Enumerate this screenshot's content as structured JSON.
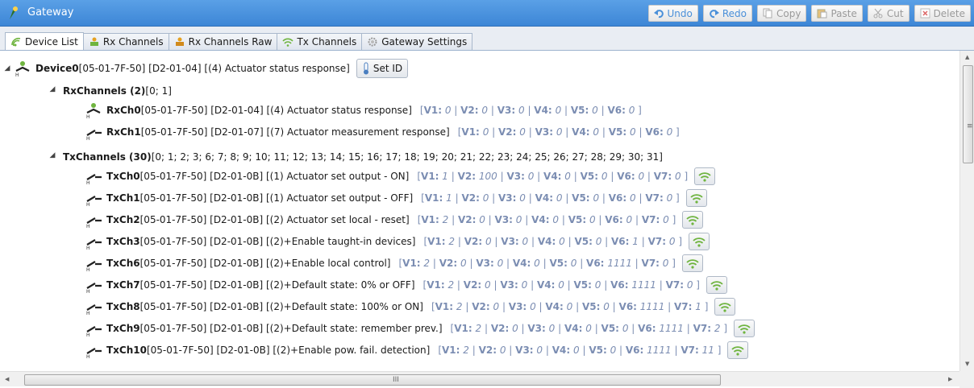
{
  "window": {
    "title": "Gateway"
  },
  "toolbar": [
    {
      "label": "Undo",
      "icon": "undo-icon",
      "active": true
    },
    {
      "label": "Redo",
      "icon": "redo-icon",
      "active": true
    },
    {
      "label": "Copy",
      "icon": "copy-icon",
      "active": false
    },
    {
      "label": "Paste",
      "icon": "paste-icon",
      "active": false
    },
    {
      "label": "Cut",
      "icon": "cut-icon",
      "active": false
    },
    {
      "label": "Delete",
      "icon": "delete-icon",
      "active": false
    }
  ],
  "tabs": [
    {
      "label": "Device List",
      "icon": "device-list-icon",
      "selected": true
    },
    {
      "label": "Rx Channels",
      "icon": "rx-channels-icon",
      "selected": false
    },
    {
      "label": "Rx Channels Raw",
      "icon": "rx-channels-raw-icon",
      "selected": false
    },
    {
      "label": "Tx Channels",
      "icon": "tx-channels-icon",
      "selected": false
    },
    {
      "label": "Gateway Settings",
      "icon": "gateway-settings-icon",
      "selected": false
    }
  ],
  "tree": {
    "device": {
      "name": "Device0",
      "info": " [05-01-7F-50] [D2-01-04] [(4) Actuator status response]",
      "set_id_label": "Set ID"
    },
    "rx_group": {
      "name": "RxChannels (2)",
      "info": " [0; 1]"
    },
    "rx_channels": [
      {
        "name": "RxCh0",
        "info": " [05-01-7F-50] [D2-01-04] [(4) Actuator status response]",
        "vals": [
          [
            "V1:",
            "0"
          ],
          [
            "V2:",
            "0"
          ],
          [
            "V3:",
            "0"
          ],
          [
            "V4:",
            "0"
          ],
          [
            "V5:",
            "0"
          ],
          [
            "V6:",
            "0"
          ]
        ]
      },
      {
        "name": "RxCh1",
        "info": " [05-01-7F-50] [D2-01-07] [(7) Actuator measurement response]",
        "vals": [
          [
            "V1:",
            "0"
          ],
          [
            "V2:",
            "0"
          ],
          [
            "V3:",
            "0"
          ],
          [
            "V4:",
            "0"
          ],
          [
            "V5:",
            "0"
          ],
          [
            "V6:",
            "0"
          ]
        ]
      }
    ],
    "tx_group": {
      "name": "TxChannels (30)",
      "info": " [0; 1; 2; 3; 6; 7; 8; 9; 10; 11; 12; 13; 14; 15; 16; 17; 18; 19; 20; 21; 22; 23; 24; 25; 26; 27; 28; 29; 30; 31]"
    },
    "tx_channels": [
      {
        "name": "TxCh0",
        "info": " [05-01-7F-50] [D2-01-0B] [(1) Actuator set output - ON]",
        "vals": [
          [
            "V1:",
            "1"
          ],
          [
            "V2:",
            "100"
          ],
          [
            "V3:",
            "0"
          ],
          [
            "V4:",
            "0"
          ],
          [
            "V5:",
            "0"
          ],
          [
            "V6:",
            "0"
          ],
          [
            "V7:",
            "0"
          ]
        ]
      },
      {
        "name": "TxCh1",
        "info": " [05-01-7F-50] [D2-01-0B] [(1) Actuator set output - OFF]",
        "vals": [
          [
            "V1:",
            "1"
          ],
          [
            "V2:",
            "0"
          ],
          [
            "V3:",
            "0"
          ],
          [
            "V4:",
            "0"
          ],
          [
            "V5:",
            "0"
          ],
          [
            "V6:",
            "0"
          ],
          [
            "V7:",
            "0"
          ]
        ]
      },
      {
        "name": "TxCh2",
        "info": " [05-01-7F-50] [D2-01-0B] [(2) Actuator set local - reset]",
        "vals": [
          [
            "V1:",
            "2"
          ],
          [
            "V2:",
            "0"
          ],
          [
            "V3:",
            "0"
          ],
          [
            "V4:",
            "0"
          ],
          [
            "V5:",
            "0"
          ],
          [
            "V6:",
            "0"
          ],
          [
            "V7:",
            "0"
          ]
        ]
      },
      {
        "name": "TxCh3",
        "info": " [05-01-7F-50] [D2-01-0B] [(2)+Enable taught-in devices]",
        "vals": [
          [
            "V1:",
            "2"
          ],
          [
            "V2:",
            "0"
          ],
          [
            "V3:",
            "0"
          ],
          [
            "V4:",
            "0"
          ],
          [
            "V5:",
            "0"
          ],
          [
            "V6:",
            "1"
          ],
          [
            "V7:",
            "0"
          ]
        ]
      },
      {
        "name": "TxCh6",
        "info": " [05-01-7F-50] [D2-01-0B] [(2)+Enable local control]",
        "vals": [
          [
            "V1:",
            "2"
          ],
          [
            "V2:",
            "0"
          ],
          [
            "V3:",
            "0"
          ],
          [
            "V4:",
            "0"
          ],
          [
            "V5:",
            "0"
          ],
          [
            "V6:",
            "1111"
          ],
          [
            "V7:",
            "0"
          ]
        ]
      },
      {
        "name": "TxCh7",
        "info": " [05-01-7F-50] [D2-01-0B] [(2)+Default state: 0% or OFF]",
        "vals": [
          [
            "V1:",
            "2"
          ],
          [
            "V2:",
            "0"
          ],
          [
            "V3:",
            "0"
          ],
          [
            "V4:",
            "0"
          ],
          [
            "V5:",
            "0"
          ],
          [
            "V6:",
            "1111"
          ],
          [
            "V7:",
            "0"
          ]
        ]
      },
      {
        "name": "TxCh8",
        "info": " [05-01-7F-50] [D2-01-0B] [(2)+Default state: 100% or ON]",
        "vals": [
          [
            "V1:",
            "2"
          ],
          [
            "V2:",
            "0"
          ],
          [
            "V3:",
            "0"
          ],
          [
            "V4:",
            "0"
          ],
          [
            "V5:",
            "0"
          ],
          [
            "V6:",
            "1111"
          ],
          [
            "V7:",
            "1"
          ]
        ]
      },
      {
        "name": "TxCh9",
        "info": " [05-01-7F-50] [D2-01-0B] [(2)+Default state: remember prev.]",
        "vals": [
          [
            "V1:",
            "2"
          ],
          [
            "V2:",
            "0"
          ],
          [
            "V3:",
            "0"
          ],
          [
            "V4:",
            "0"
          ],
          [
            "V5:",
            "0"
          ],
          [
            "V6:",
            "1111"
          ],
          [
            "V7:",
            "2"
          ]
        ]
      },
      {
        "name": "TxCh10",
        "info": " [05-01-7F-50] [D2-01-0B] [(2)+Enable pow. fail. detection]",
        "vals": [
          [
            "V1:",
            "2"
          ],
          [
            "V2:",
            "0"
          ],
          [
            "V3:",
            "0"
          ],
          [
            "V4:",
            "0"
          ],
          [
            "V5:",
            "0"
          ],
          [
            "V6:",
            "1111"
          ],
          [
            "V7:",
            "11"
          ]
        ]
      }
    ]
  },
  "colors": {
    "titlebar": "#3d86d6",
    "value_text": "#7b8db2",
    "send_icon": "#6fb43f"
  },
  "scroll": {
    "horizontal_grip": "III"
  }
}
